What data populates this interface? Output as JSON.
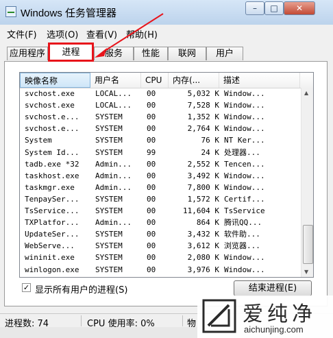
{
  "window": {
    "title": "Windows 任务管理器"
  },
  "controls": {
    "minimize": "–",
    "maximize": "□",
    "close": "✕"
  },
  "menu": [
    "文件(F)",
    "选项(O)",
    "查看(V)",
    "帮助(H)"
  ],
  "tabs": [
    {
      "label": "应用程序"
    },
    {
      "label": "进程"
    },
    {
      "label": "服务"
    },
    {
      "label": "性能"
    },
    {
      "label": "联网"
    },
    {
      "label": "用户"
    }
  ],
  "columns": [
    "映像名称",
    "用户名",
    "CPU",
    "内存(...",
    "描述"
  ],
  "rows": [
    [
      "svchost.exe",
      "LOCAL...",
      "00",
      "5,032 K",
      "Window..."
    ],
    [
      "svchost.exe",
      "LOCAL...",
      "00",
      "7,528 K",
      "Window..."
    ],
    [
      "svchost.e...",
      "SYSTEM",
      "00",
      "1,352 K",
      "Window..."
    ],
    [
      "svchost.e...",
      "SYSTEM",
      "00",
      "2,764 K",
      "Window..."
    ],
    [
      "System",
      "SYSTEM",
      "00",
      "76 K",
      "NT Ker..."
    ],
    [
      "System Id...",
      "SYSTEM",
      "99",
      "24 K",
      "处理器..."
    ],
    [
      "tadb.exe *32",
      "Admin...",
      "00",
      "2,552 K",
      "Tencen..."
    ],
    [
      "taskhost.exe",
      "Admin...",
      "00",
      "3,492 K",
      "Window..."
    ],
    [
      "taskmgr.exe",
      "Admin...",
      "00",
      "7,800 K",
      "Window..."
    ],
    [
      "TenpaySer...",
      "SYSTEM",
      "00",
      "1,572 K",
      "Certif..."
    ],
    [
      "TsService...",
      "SYSTEM",
      "00",
      "11,604 K",
      "TsService"
    ],
    [
      "TXPlatfor...",
      "Admin...",
      "00",
      "864 K",
      "腾讯QQ..."
    ],
    [
      "UpdateSer...",
      "SYSTEM",
      "00",
      "3,432 K",
      "软件助..."
    ],
    [
      "WebServe...",
      "SYSTEM",
      "00",
      "3,612 K",
      "浏览器..."
    ],
    [
      "wininit.exe",
      "SYSTEM",
      "00",
      "2,080 K",
      "Window..."
    ],
    [
      "winlogon.exe",
      "SYSTEM",
      "00",
      "3,976 K",
      "Window..."
    ]
  ],
  "show_all_users": {
    "label": "显示所有用户的进程(S)",
    "checked": true,
    "mark": "✓"
  },
  "end_process_button": "结束进程(E)",
  "status": {
    "processes": "进程数: 74",
    "cpu": "CPU 使用率: 0%",
    "memory_partial": "物"
  },
  "watermark": {
    "brand": "爱纯净",
    "url": "aichunjing.com"
  },
  "colors": {
    "highlight": "#e8141b",
    "title_bg": "#cfe0f2"
  }
}
